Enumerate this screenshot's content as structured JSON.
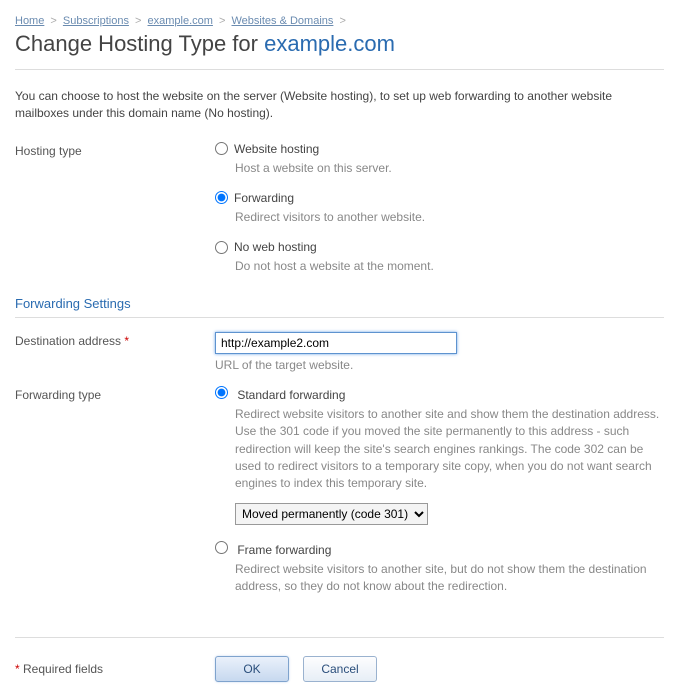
{
  "breadcrumb": {
    "items": [
      "Home",
      "Subscriptions",
      "example.com",
      "Websites & Domains"
    ]
  },
  "title": {
    "prefix": "Change Hosting Type for ",
    "domain": "example.com"
  },
  "intro": "You can choose to host the website on the server (Website hosting), to set up web forwarding to another website mailboxes under this domain name (No hosting).",
  "hosting_type": {
    "label": "Hosting type",
    "options": {
      "website": {
        "label": "Website hosting",
        "hint": "Host a website on this server."
      },
      "forwarding": {
        "label": "Forwarding",
        "hint": "Redirect visitors to another website."
      },
      "none": {
        "label": "No web hosting",
        "hint": "Do not host a website at the moment."
      }
    }
  },
  "forwarding_section": {
    "heading": "Forwarding Settings",
    "destination": {
      "label": "Destination address",
      "value": "http://example2.com",
      "hint": "URL of the target website."
    },
    "type": {
      "label": "Forwarding type",
      "standard": {
        "label": "Standard forwarding",
        "hint": "Redirect website visitors to another site and show them the destination address. Use the 301 code if you moved the site permanently to this address - such redirection will keep the site's search engines rankings. The code 302 can be used to redirect visitors to a temporary site copy, when you do not want search engines to index this temporary site.",
        "select_value": "Moved permanently (code 301)"
      },
      "frame": {
        "label": "Frame forwarding",
        "hint": "Redirect website visitors to another site, but do not show them the destination address, so they do not know about the redirection."
      }
    }
  },
  "footer": {
    "required_note": "Required fields",
    "ok": "OK",
    "cancel": "Cancel"
  }
}
